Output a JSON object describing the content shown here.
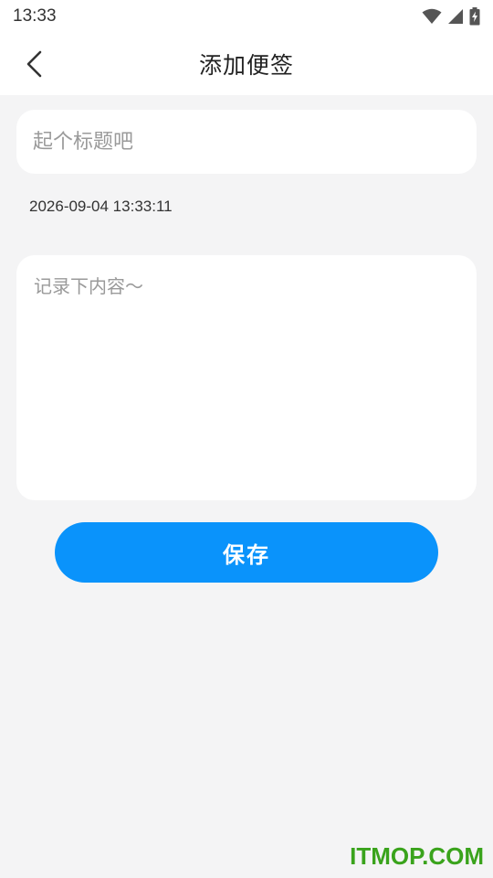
{
  "status_bar": {
    "time": "13:33",
    "icons": [
      "wifi-icon",
      "cellular-signal-icon",
      "battery-charging-icon"
    ]
  },
  "header": {
    "title": "添加便签",
    "back_icon": "chevron-left-icon"
  },
  "note": {
    "title_placeholder": "起个标题吧",
    "title_value": "",
    "timestamp": "2026-09-04 13:33:11",
    "content_placeholder": "记录下内容～",
    "content_value": ""
  },
  "actions": {
    "save_label": "保存"
  },
  "watermark": "ITMOP.COM",
  "colors": {
    "accent": "#0a93fb",
    "background": "#f4f4f5",
    "watermark": "#3aa31c"
  }
}
